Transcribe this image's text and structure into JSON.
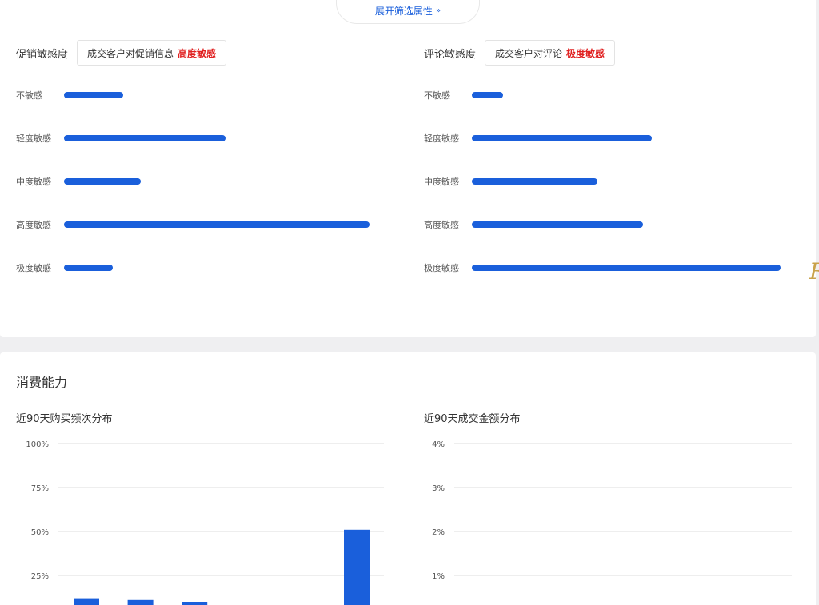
{
  "expand_filter": {
    "label": "展开筛选属性",
    "icon": "double-chevron-down-icon"
  },
  "promotion_sensitivity": {
    "title": "促销敏感度",
    "tag_prefix": "成交客户对促销信息",
    "tag_value": "高度敏感",
    "rows": [
      {
        "label": "不敏感",
        "value": 0.195
      },
      {
        "label": "轻度敏感",
        "value": 0.53
      },
      {
        "label": "中度敏感",
        "value": 0.252
      },
      {
        "label": "高度敏感",
        "value": 1.0
      },
      {
        "label": "极度敏感",
        "value": 0.16
      }
    ]
  },
  "review_sensitivity": {
    "title": "评论敏感度",
    "tag_prefix": "成交客户对评论",
    "tag_value": "极度敏感",
    "rows": [
      {
        "label": "不敏感",
        "value": 0.1
      },
      {
        "label": "轻度敏感",
        "value": 0.584
      },
      {
        "label": "中度敏感",
        "value": 0.407
      },
      {
        "label": "高度敏感",
        "value": 0.555
      },
      {
        "label": "极度敏感",
        "value": 1.0
      }
    ]
  },
  "consumption": {
    "title": "消费能力"
  },
  "chart_data": [
    {
      "type": "bar",
      "title": "近90天购买频次分布",
      "y_ticks": [
        "100%",
        "75%",
        "50%",
        "25%"
      ],
      "ylim": [
        0,
        100
      ],
      "values": [
        12,
        11,
        10,
        null,
        null,
        51
      ]
    },
    {
      "type": "bar",
      "title": "近90天成交金额分布",
      "y_ticks": [
        "4%",
        "3%",
        "2%",
        "1%"
      ],
      "ylim": [
        0,
        4
      ],
      "values": []
    }
  ],
  "colors": {
    "accent": "#1a5fdb",
    "highlight": "#e02020"
  }
}
